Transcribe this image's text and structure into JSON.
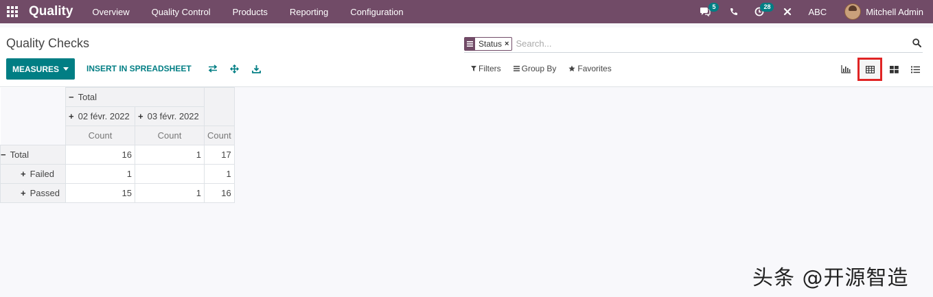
{
  "navbar": {
    "app_name": "Quality",
    "menu": [
      "Overview",
      "Quality Control",
      "Products",
      "Reporting",
      "Configuration"
    ],
    "messages_count": "5",
    "activities_count": "28",
    "company": "ABC",
    "user": "Mitchell Admin",
    "bg_color": "#714b67"
  },
  "control_panel": {
    "title": "Quality Checks",
    "search": {
      "facet_label": "Status",
      "facet_remove": "×",
      "placeholder": "Search..."
    },
    "measures_label": "MEASURES",
    "insert_spreadsheet_label": "INSERT IN SPREADSHEET",
    "tools": [
      "flip-axis-icon",
      "expand-all-icon",
      "download-icon"
    ],
    "filters_label": "Filters",
    "group_by_label": "Group By",
    "favorites_label": "Favorites",
    "views": [
      "graph-icon",
      "pivot-icon",
      "kanban-icon",
      "list-icon"
    ],
    "active_view": "pivot-icon",
    "accent_color": "#017e84"
  },
  "pivot": {
    "col_total_label": "Total",
    "col_groups": [
      "02 févr. 2022",
      "03 févr. 2022"
    ],
    "measure_label": "Count",
    "rows": [
      {
        "label": "Total",
        "sign": "−",
        "values": [
          "16",
          "1",
          "17"
        ]
      },
      {
        "label": "Failed",
        "sign": "+",
        "values": [
          "1",
          "",
          "1"
        ]
      },
      {
        "label": "Passed",
        "sign": "+",
        "values": [
          "15",
          "1",
          "16"
        ]
      }
    ]
  },
  "watermark": "头条 @开源智造"
}
